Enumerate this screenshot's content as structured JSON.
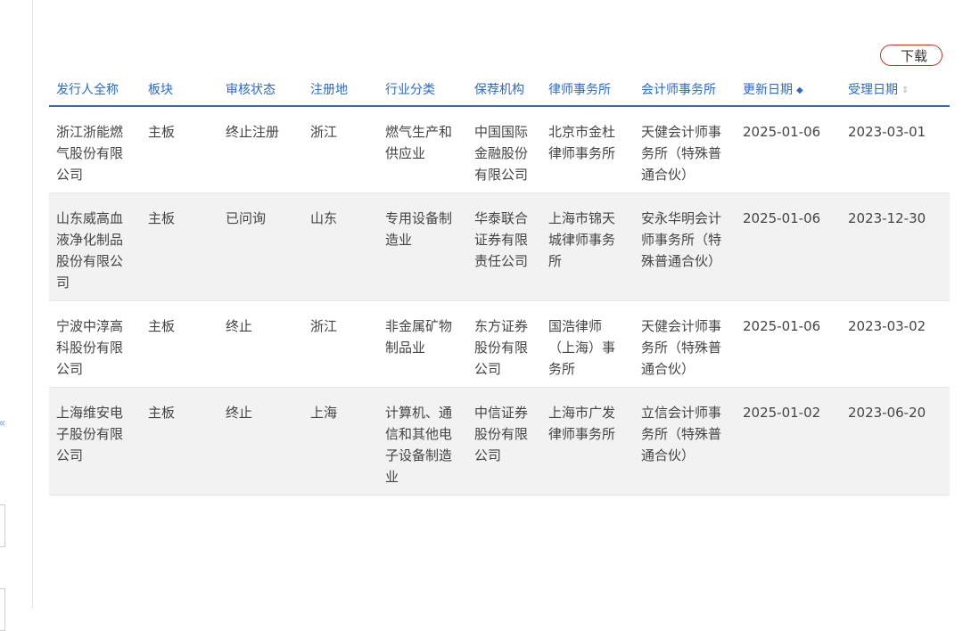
{
  "toolbar": {
    "download_label": "下载"
  },
  "table": {
    "headers": {
      "issuer": "发行人全称",
      "board": "板块",
      "status": "审核状态",
      "region": "注册地",
      "industry": "行业分类",
      "sponsor": "保荐机构",
      "law_firm": "律师事务所",
      "accounting_firm": "会计师事务所",
      "updated": "更新日期",
      "accepted": "受理日期"
    },
    "sort": {
      "updated_icon": "sort-desc-icon",
      "accepted_icon": "sort-both-icon"
    },
    "rows": [
      {
        "issuer": "浙江浙能燃气股份有限公司",
        "board": "主板",
        "status": "终止注册",
        "region": "浙江",
        "industry": "燃气生产和供应业",
        "sponsor": "中国国际金融股份有限公司",
        "law_firm": "北京市金杜律师事务所",
        "accounting_firm": "天健会计师事务所（特殊普通合伙）",
        "updated": "2025-01-06",
        "accepted": "2023-03-01"
      },
      {
        "issuer": "山东威高血液净化制品股份有限公司",
        "board": "主板",
        "status": "已问询",
        "region": "山东",
        "industry": "专用设备制造业",
        "sponsor": "华泰联合证券有限责任公司",
        "law_firm": "上海市锦天城律师事务所",
        "accounting_firm": "安永华明会计师事务所（特殊普通合伙）",
        "updated": "2025-01-06",
        "accepted": "2023-12-30"
      },
      {
        "issuer": "宁波中淳高科股份有限公司",
        "board": "主板",
        "status": "终止",
        "region": "浙江",
        "industry": "非金属矿物制品业",
        "sponsor": "东方证券股份有限公司",
        "law_firm": "国浩律师（上海）事务所",
        "accounting_firm": "天健会计师事务所（特殊普通合伙）",
        "updated": "2025-01-06",
        "accepted": "2023-03-02"
      },
      {
        "issuer": "上海维安电子股份有限公司",
        "board": "主板",
        "status": "终止",
        "region": "上海",
        "industry": "计算机、通信和其他电子设备制造业",
        "sponsor": "中信证券股份有限公司",
        "law_firm": "上海市广发律师事务所",
        "accounting_firm": "立信会计师事务所（特殊普通合伙）",
        "updated": "2025-01-02",
        "accepted": "2023-06-20"
      }
    ]
  },
  "sidebar": {
    "collapse_icon": "chevron-left-icon"
  }
}
